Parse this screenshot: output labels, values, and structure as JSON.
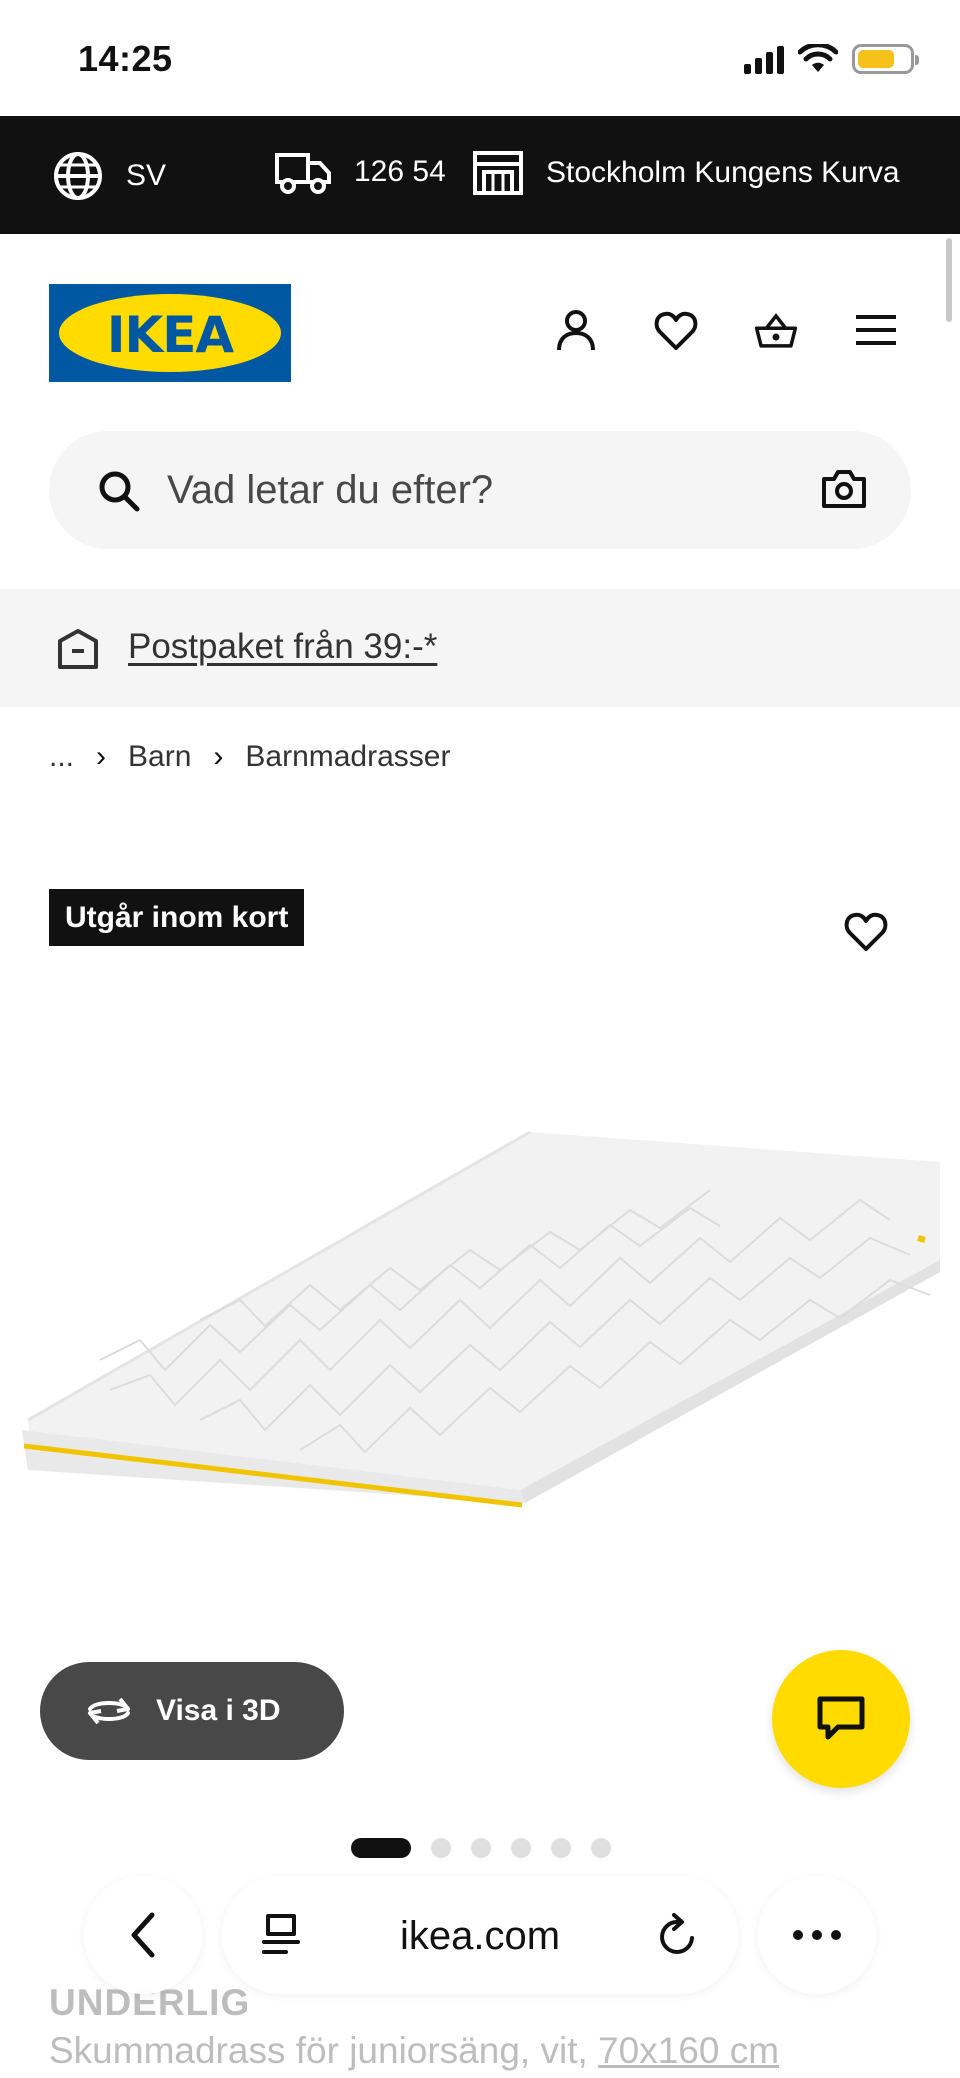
{
  "status_bar": {
    "time": "14:25"
  },
  "info_bar": {
    "language": "SV",
    "postal_code": "126 54",
    "store": "Stockholm Kungens Kurva"
  },
  "header": {
    "logo_text": "IKEA"
  },
  "search": {
    "placeholder": "Vad letar du efter?"
  },
  "promo": {
    "text": "Postpaket från 39:-*"
  },
  "breadcrumb": {
    "ellipsis": "...",
    "items": [
      "Barn",
      "Barnmadrasser"
    ]
  },
  "product": {
    "badge": "Utgår inom kort",
    "view_3d_label": "Visa i 3D",
    "name": "UNDERLIG",
    "description": "Skummadrass för juniorsäng, vit,",
    "size": "70x160 cm",
    "image_count": 6,
    "active_image": 1
  },
  "browser": {
    "url": "ikea.com"
  },
  "colors": {
    "brand_blue": "#0058a3",
    "brand_yellow": "#ffdb00",
    "dark": "#111111"
  }
}
